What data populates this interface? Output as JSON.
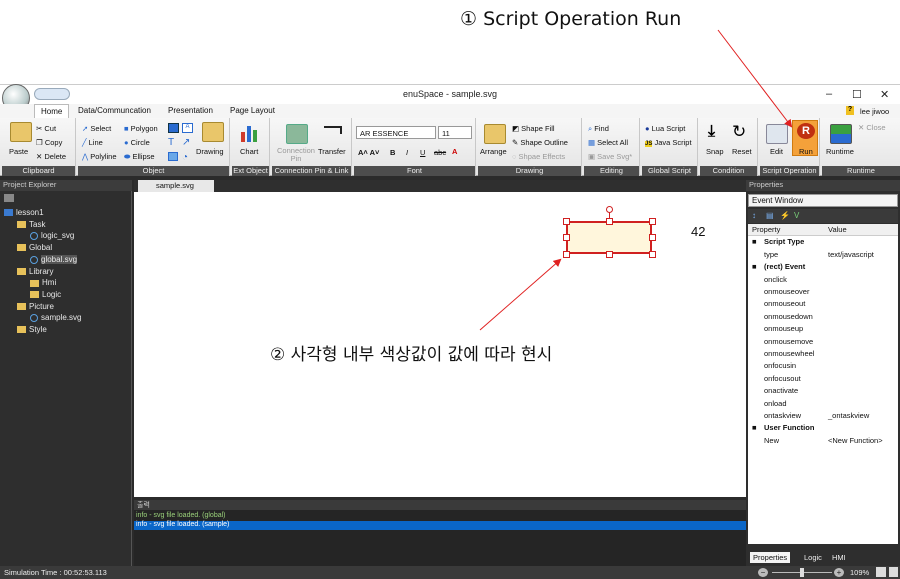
{
  "annotations": {
    "step1": "① Script Operation Run",
    "step2": "② 사각형 내부 색상값이 값에 따라 현시"
  },
  "window": {
    "title": "enuSpace - sample.svg",
    "user": "lee jiwoo",
    "controls": {
      "minimize": "–",
      "maximize": "☐",
      "close": "✕"
    }
  },
  "menu_tabs": [
    "Home",
    "Data/Communcation",
    "Presentation",
    "Page Layout"
  ],
  "ribbon": {
    "clipboard": {
      "label": "Clipboard",
      "paste": "Paste",
      "cut": "Cut",
      "copy": "Copy",
      "delete": "Delete"
    },
    "object": {
      "label": "Object",
      "select": "Select",
      "line": "Line",
      "polyline": "Polyline",
      "polygon": "Polygon",
      "circle": "Circle",
      "ellipse": "Ellipse",
      "drawing": "Drawing"
    },
    "ext_object": {
      "label": "Ext Object",
      "chart": "Chart"
    },
    "connection": {
      "label": "Connection Pin & Link",
      "pin": "Connection Pin",
      "transfer": "Transfer"
    },
    "font": {
      "label": "Font",
      "family": "AR ESSENCE",
      "size": "11"
    },
    "drawing": {
      "label": "Drawing",
      "arrange": "Arrange",
      "fill": "Shape Fill",
      "outline": "Shape Outline",
      "effects": "Shpae Effects"
    },
    "editing": {
      "label": "Editing",
      "find": "Find",
      "select_all": "Select All",
      "save_svg": "Save Svg*"
    },
    "global_script": {
      "label": "Global Script",
      "lua": "Lua Script",
      "java": "Java Script"
    },
    "condition": {
      "label": "Condition",
      "snap": "Snap",
      "reset": "Reset"
    },
    "script_operation": {
      "label": "Script Operation",
      "edit": "Edit",
      "run": "Run"
    },
    "runtime": {
      "label": "Runtime",
      "runtime": "Runtime",
      "close": "Close"
    }
  },
  "project_explorer": {
    "title": "Project Explorer",
    "items": [
      {
        "label": "lesson1",
        "level": 0,
        "kind": "project"
      },
      {
        "label": "Task",
        "level": 1,
        "kind": "folder"
      },
      {
        "label": "logic_svg",
        "level": 2,
        "kind": "file"
      },
      {
        "label": "Global",
        "level": 1,
        "kind": "folder"
      },
      {
        "label": "global.svg",
        "level": 2,
        "kind": "file"
      },
      {
        "label": "Library",
        "level": 1,
        "kind": "folder"
      },
      {
        "label": "Hmi",
        "level": 2,
        "kind": "folder"
      },
      {
        "label": "Logic",
        "level": 2,
        "kind": "folder"
      },
      {
        "label": "Picture",
        "level": 1,
        "kind": "folder"
      },
      {
        "label": "sample.svg",
        "level": 2,
        "kind": "file"
      },
      {
        "label": "Style",
        "level": 1,
        "kind": "folder"
      }
    ]
  },
  "document": {
    "tab": "sample.svg",
    "value_label": "42"
  },
  "output": {
    "title": "출력",
    "lines": [
      "info - svg file loaded. (global)",
      "info - svg file loaded. (sample)"
    ]
  },
  "properties": {
    "title": "Properties",
    "selector": "Event Window",
    "col_property": "Property",
    "col_value": "Value",
    "rows": [
      {
        "k": "Script Type",
        "v": "",
        "cat": true
      },
      {
        "k": "type",
        "v": "text/javascript",
        "cat": false
      },
      {
        "k": "(rect) Event",
        "v": "",
        "cat": true
      },
      {
        "k": "onclick",
        "v": "",
        "cat": false
      },
      {
        "k": "onmouseover",
        "v": "",
        "cat": false
      },
      {
        "k": "onmouseout",
        "v": "",
        "cat": false
      },
      {
        "k": "onmousedown",
        "v": "",
        "cat": false
      },
      {
        "k": "onmouseup",
        "v": "",
        "cat": false
      },
      {
        "k": "onmousemove",
        "v": "",
        "cat": false
      },
      {
        "k": "onmousewheel",
        "v": "",
        "cat": false
      },
      {
        "k": "onfocusin",
        "v": "",
        "cat": false
      },
      {
        "k": "onfocusout",
        "v": "",
        "cat": false
      },
      {
        "k": "onactivate",
        "v": "",
        "cat": false
      },
      {
        "k": "onload",
        "v": "",
        "cat": false
      },
      {
        "k": "ontaskview",
        "v": "_ontaskview",
        "cat": false
      },
      {
        "k": "User Function",
        "v": "",
        "cat": true
      },
      {
        "k": "New",
        "v": "<New Function>",
        "cat": false
      }
    ],
    "footer_tabs": [
      "Properties",
      "Logic",
      "HMI"
    ]
  },
  "status": {
    "sim_time": "Simulation Time : 00:52:53.113",
    "zoom": "109%"
  },
  "colors": {
    "run_accent": "#f4a13a",
    "annotation_arrow": "#e02020",
    "rect_fill": "#fff6dc"
  }
}
